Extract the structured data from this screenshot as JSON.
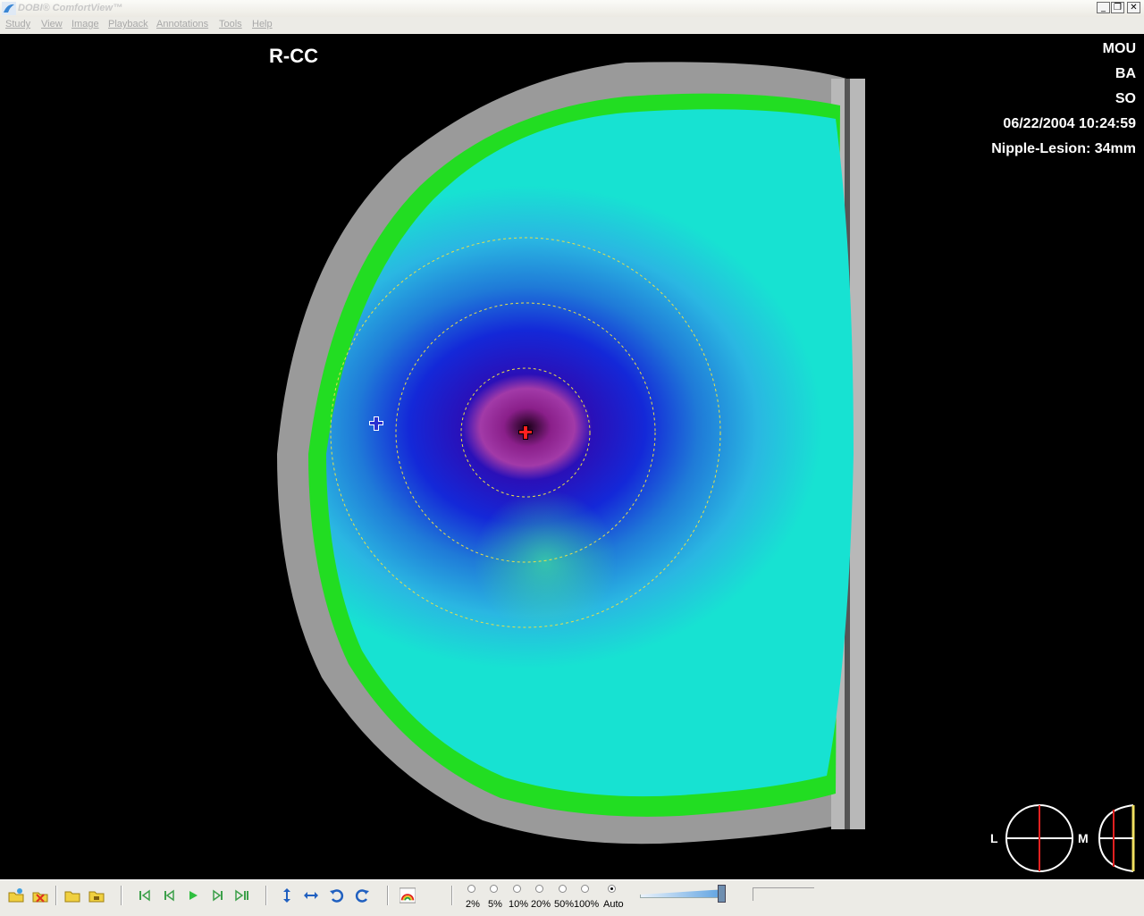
{
  "window": {
    "title": "DOBI® ComfortView™",
    "buttons": [
      "_",
      "❐",
      "✕"
    ]
  },
  "menu": {
    "items": [
      "Study",
      "View",
      "Image",
      "Playback",
      "Annotations",
      "Tools",
      "Help"
    ]
  },
  "image": {
    "view_label": "R-CC",
    "info": [
      "MOU",
      "BA",
      "SO",
      "06/22/2004 10:24:59",
      "Nipple-Lesion: 34mm"
    ],
    "orientation_left": "L",
    "orientation_right": "M"
  },
  "toolbar": {
    "icons": [
      "open-study-icon",
      "close-study-icon",
      "open-folder-icon",
      "save-folder-icon",
      "first-frame-icon",
      "previous-frame-icon",
      "play-icon",
      "next-frame-icon",
      "last-frame-icon",
      "flip-vertical-icon",
      "flip-horizontal-icon",
      "rotate-left-icon",
      "rotate-right-icon",
      "color-map-icon"
    ],
    "threshold_options": [
      "2%",
      "5%",
      "10%",
      "20%",
      "50%",
      "100%",
      "Auto"
    ],
    "threshold_selected": "Auto",
    "colors": {
      "accent": "#2060c0",
      "play": "#2fbf3f",
      "nav": "#3ca04a"
    }
  }
}
